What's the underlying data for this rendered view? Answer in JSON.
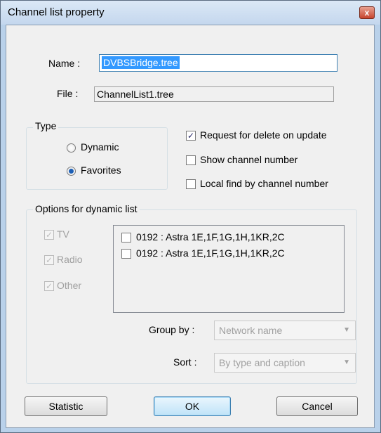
{
  "window": {
    "title": "Channel list property",
    "close_glyph": "x"
  },
  "name_field": {
    "label": "Name :",
    "value": "DVBSBridge.tree"
  },
  "file_field": {
    "label": "File :",
    "value": "ChannelList1.tree"
  },
  "type_group": {
    "title": "Type",
    "options": [
      {
        "label": "Dynamic",
        "checked": false
      },
      {
        "label": "Favorites",
        "checked": true
      }
    ]
  },
  "flags": [
    {
      "label": "Request for delete on update",
      "checked": true
    },
    {
      "label": "Show channel number",
      "checked": false
    },
    {
      "label": "Local find by channel number",
      "checked": false
    }
  ],
  "dynamic_group": {
    "title": "Options for dynamic list",
    "filters": [
      {
        "label": "TV",
        "checked": true
      },
      {
        "label": "Radio",
        "checked": true
      },
      {
        "label": "Other",
        "checked": true
      }
    ],
    "satellites": [
      {
        "label": "0192 : Astra 1E,1F,1G,1H,1KR,2C",
        "checked": false
      },
      {
        "label": "0192 : Astra 1E,1F,1G,1H,1KR,2C",
        "checked": false
      }
    ],
    "group_by": {
      "label": "Group by :",
      "value": "Network name"
    },
    "sort": {
      "label": "Sort :",
      "value": "By type and caption"
    }
  },
  "buttons": {
    "statistic": "Statistic",
    "ok": "OK",
    "cancel": "Cancel"
  },
  "colors": {
    "selection": "#3399ff",
    "dialog_bg": "#f0f0f0",
    "title_bg": "#c4d7ee"
  }
}
